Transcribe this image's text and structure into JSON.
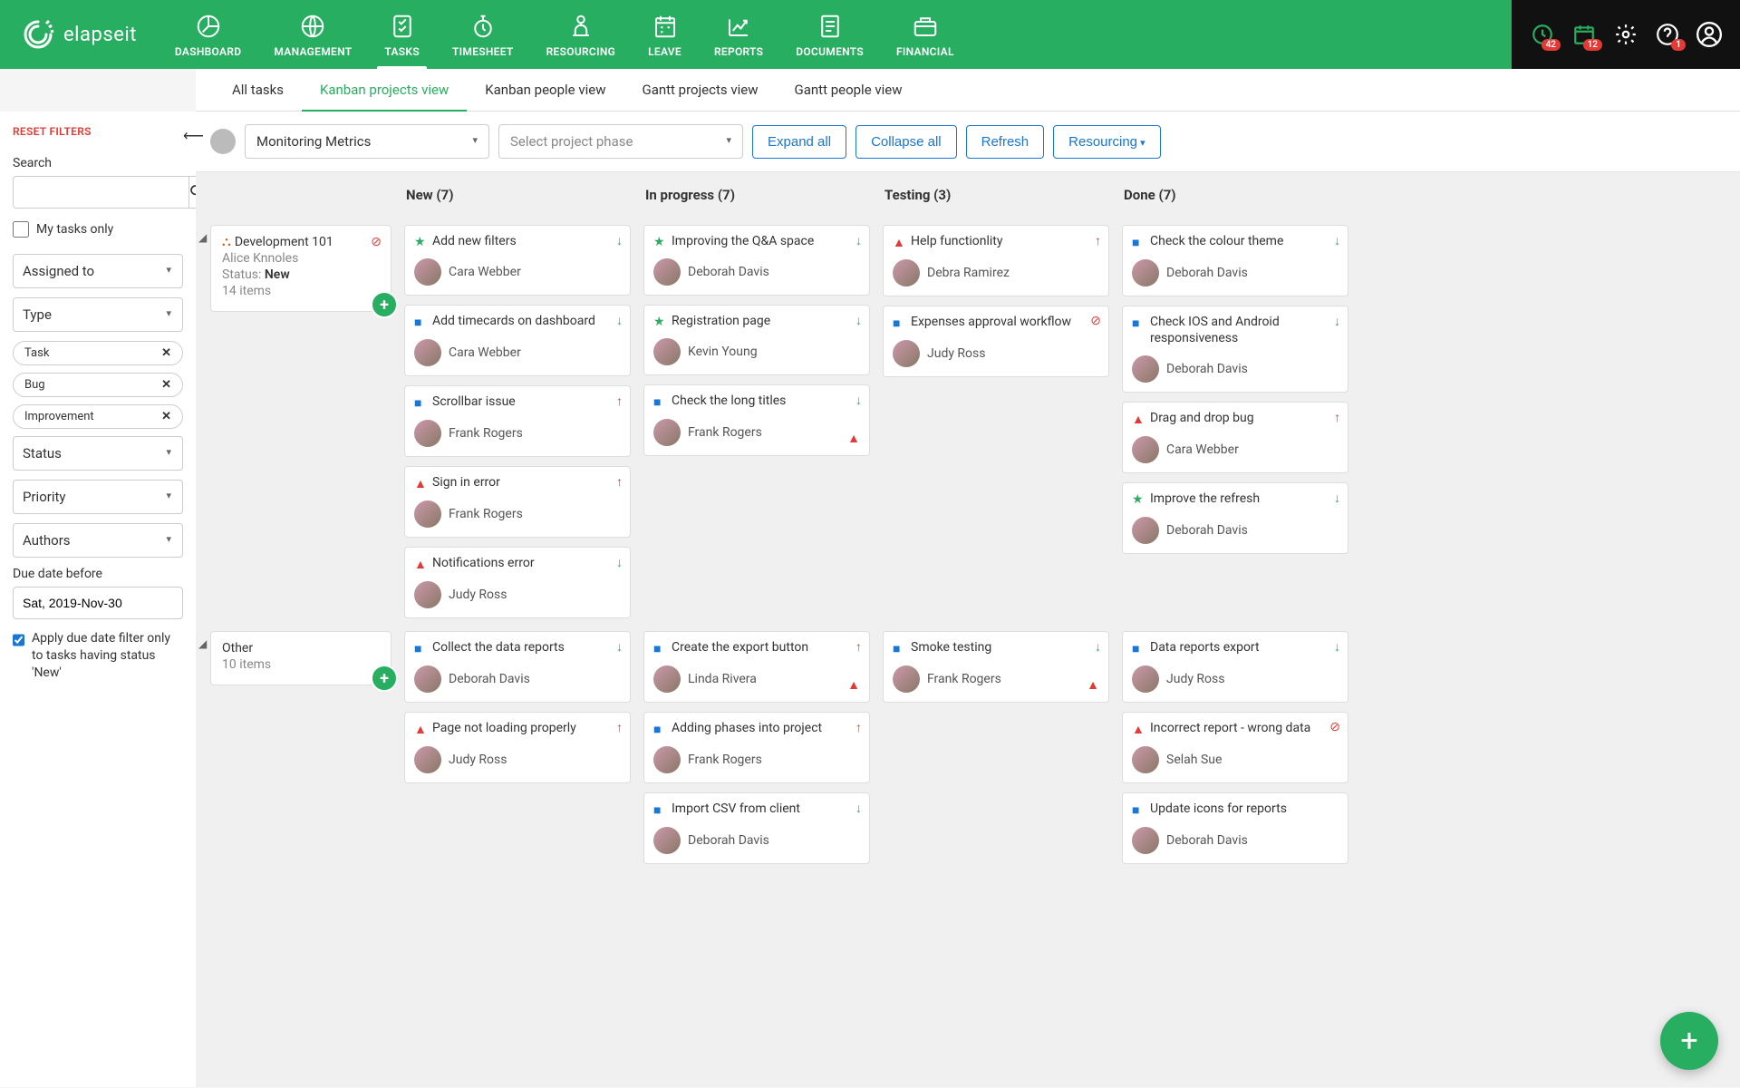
{
  "brand": "elapseit",
  "nav": [
    "DASHBOARD",
    "MANAGEMENT",
    "TASKS",
    "TIMESHEET",
    "RESOURCING",
    "LEAVE",
    "REPORTS",
    "DOCUMENTS",
    "FINANCIAL"
  ],
  "nav_active_index": 2,
  "badges": {
    "clock": "42",
    "calendar": "12",
    "help": "1"
  },
  "subnav": [
    "All tasks",
    "Kanban projects view",
    "Kanban people view",
    "Gantt projects view",
    "Gantt people view"
  ],
  "subnav_active_index": 1,
  "filters": {
    "reset": "RESET FILTERS",
    "search_label": "Search",
    "my_tasks_label": "My tasks only",
    "selects": [
      "Assigned to",
      "Type",
      "Status",
      "Priority",
      "Authors"
    ],
    "type_chips": [
      "Task",
      "Bug",
      "Improvement"
    ],
    "due_label": "Due date before",
    "due_value": "Sat, 2019-Nov-30",
    "due_check_label": "Apply due date filter only to tasks having status 'New'"
  },
  "toolbar": {
    "project": "Monitoring Metrics",
    "phase_placeholder": "Select project phase",
    "expand": "Expand all",
    "collapse": "Collapse all",
    "refresh": "Refresh",
    "resourcing": "Resourcing"
  },
  "columns": [
    "New (7)",
    "In progress (7)",
    "Testing (3)",
    "Done (7)"
  ],
  "rows": [
    {
      "title": "Development 101",
      "owner": "Alice Knnoles",
      "status_label": "Status:",
      "status": "New",
      "items_label": "14 items",
      "blocked": true,
      "phase_icon": true,
      "cols": [
        [
          {
            "type": "imp",
            "title": "Add new filters",
            "prio": "down",
            "assignee": "Cara Webber"
          },
          {
            "type": "task",
            "title": "Add timecards on dashboard",
            "prio": "down",
            "assignee": "Cara Webber"
          },
          {
            "type": "task",
            "title": "Scrollbar issue",
            "prio": "up",
            "assignee": "Frank Rogers"
          },
          {
            "type": "bug",
            "title": "Sign in error",
            "prio": "up",
            "assignee": "Frank Rogers"
          },
          {
            "type": "bug",
            "title": "Notifications error",
            "prio": "down",
            "assignee": "Judy Ross"
          }
        ],
        [
          {
            "type": "imp",
            "title": "Improving the Q&A space",
            "prio": "down",
            "assignee": "Deborah Davis"
          },
          {
            "type": "imp",
            "title": "Registration page",
            "prio": "down",
            "assignee": "Kevin Young"
          },
          {
            "type": "task",
            "title": "Check the long titles",
            "prio": "down",
            "assignee": "Frank Rogers",
            "warn": true
          }
        ],
        [
          {
            "type": "bug",
            "title": "Help functionlity",
            "prio": "up",
            "assignee": "Debra Ramirez"
          },
          {
            "type": "task",
            "title": "Expenses approval workflow",
            "prio": "blocked",
            "assignee": "Judy Ross"
          }
        ],
        [
          {
            "type": "task",
            "title": "Check the colour theme",
            "prio": "down",
            "assignee": "Deborah Davis"
          },
          {
            "type": "task",
            "title": "Check IOS and Android responsiveness",
            "prio": "down",
            "assignee": "Deborah Davis"
          },
          {
            "type": "bug",
            "title": "Drag and drop bug",
            "prio": "up",
            "assignee": "Cara Webber"
          },
          {
            "type": "imp",
            "title": "Improve the refresh",
            "prio": "down",
            "assignee": "Deborah Davis"
          }
        ]
      ]
    },
    {
      "title": "Other",
      "items_label": "10 items",
      "cols": [
        [
          {
            "type": "task",
            "title": "Collect the data reports",
            "prio": "down",
            "assignee": "Deborah Davis"
          },
          {
            "type": "bug",
            "title": "Page not loading properly",
            "prio": "up",
            "assignee": "Judy Ross"
          }
        ],
        [
          {
            "type": "task",
            "title": "Create the export button",
            "prio": "up",
            "assignee": "Linda Rivera",
            "warn": true
          },
          {
            "type": "task",
            "title": "Adding phases into project",
            "prio": "up",
            "assignee": "Frank Rogers"
          },
          {
            "type": "task",
            "title": "Import CSV from client",
            "prio": "down",
            "assignee": "Deborah Davis"
          }
        ],
        [
          {
            "type": "task",
            "title": "Smoke testing",
            "prio": "down",
            "assignee": "Frank Rogers",
            "warn": true
          }
        ],
        [
          {
            "type": "task",
            "title": "Data reports export",
            "prio": "down",
            "assignee": "Judy Ross"
          },
          {
            "type": "bug",
            "title": "Incorrect report - wrong data",
            "prio": "blocked",
            "assignee": "Selah Sue"
          },
          {
            "type": "task",
            "title": "Update icons for reports",
            "assignee": "Deborah Davis"
          }
        ]
      ]
    }
  ]
}
